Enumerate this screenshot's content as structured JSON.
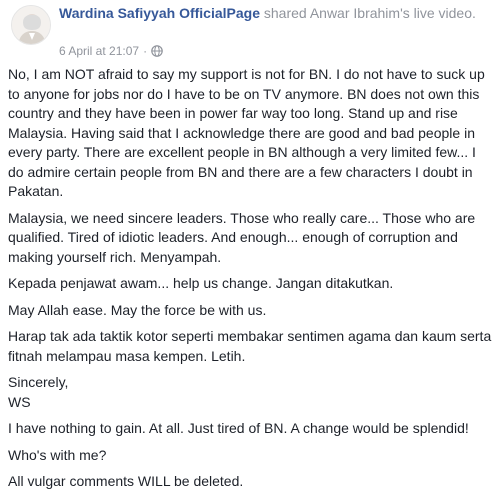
{
  "post": {
    "author": "Wardina Safiyyah OfficialPage",
    "action": "shared Anwar Ibrahim's live video.",
    "timestamp": "6 April at 21:07",
    "separator": "·",
    "privacy_icon": "globe-icon",
    "paragraphs": [
      "No, I am NOT afraid to say my support is not for BN. I do not have to suck up to anyone for jobs nor do I have to be on TV anymore. BN does not own this country and they have been in power far way too long. Stand up and rise Malaysia. Having said that I acknowledge there are good and bad people in every party. There are excellent people in BN although a very limited few... I do admire certain people from BN and there are a few characters I doubt in Pakatan.",
      "Malaysia, we need sincere leaders. Those who really care... Those who are qualified. Tired of idiotic leaders. And enough... enough of corruption and making yourself rich. Menyampah.",
      "Kepada penjawat awam... help us change. Jangan ditakutkan.",
      "May Allah ease. May the force be with us.",
      "Harap tak ada taktik kotor seperti membakar sentimen agama dan kaum serta fitnah melampau masa kempen. Letih.",
      "Sincerely,\nWS",
      "I have nothing to gain. At all. Just tired of BN. A change would be splendid!",
      "Who's with me?",
      "All vulgar comments WILL be deleted."
    ]
  },
  "colors": {
    "link": "#365899",
    "muted": "#90949c",
    "text": "#1d2129"
  }
}
